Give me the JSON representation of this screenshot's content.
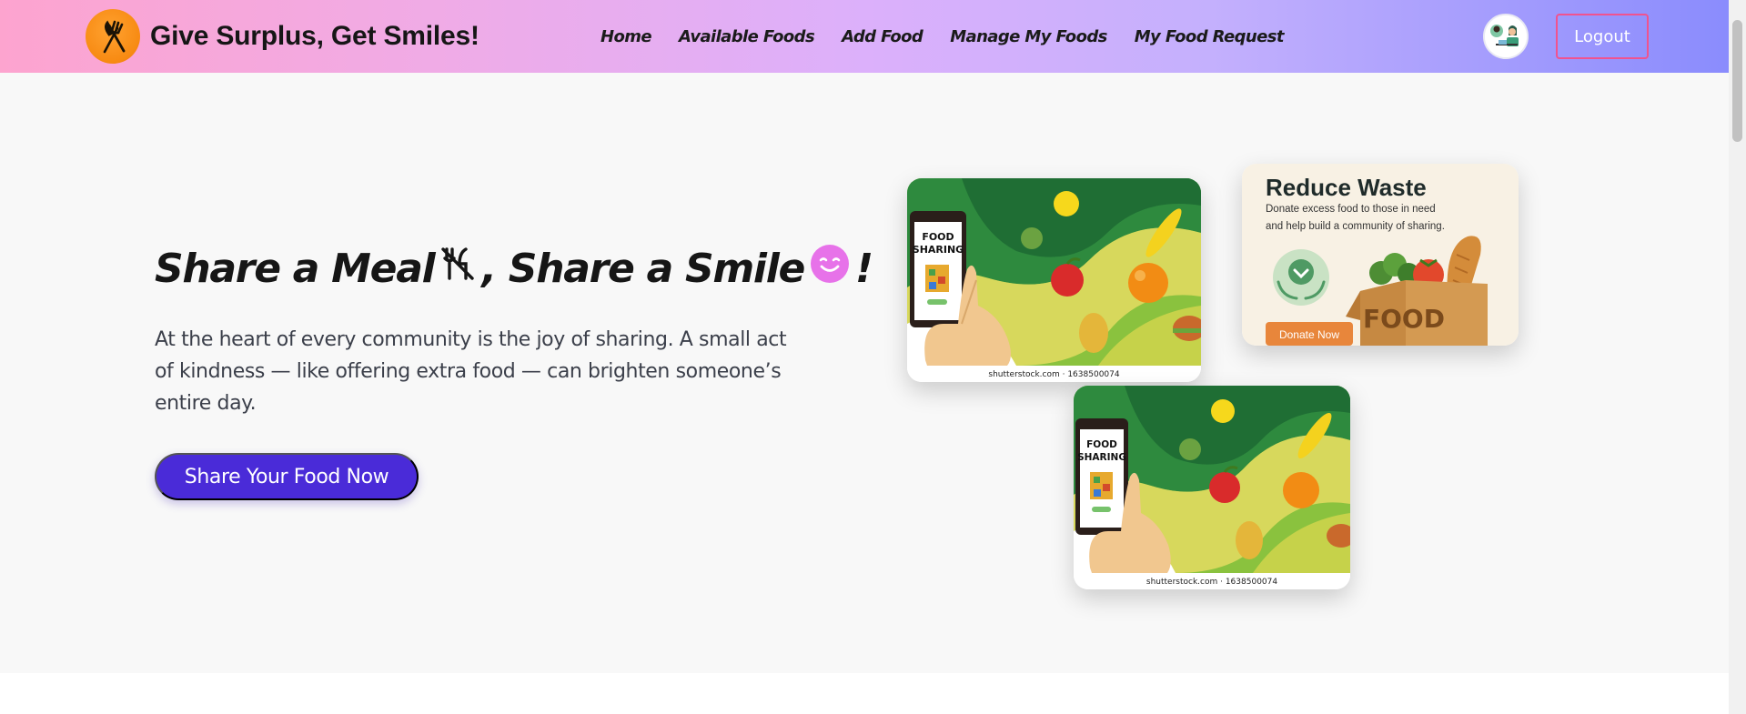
{
  "brand": {
    "title": "Give Surplus, Get Smiles!"
  },
  "nav": {
    "links": [
      "Home",
      "Available Foods",
      "Add Food",
      "Manage My Foods",
      "My Food Request"
    ],
    "logout": "Logout"
  },
  "hero": {
    "headline_part1": "Share a Meal",
    "headline_part2": ", Share a Smile",
    "headline_part3": "!",
    "description": "At the heart of every community is the joy of sharing. A small act of kindness — like offering extra food — can brighten someone’s entire day.",
    "cta": "Share Your Food Now"
  },
  "cards": {
    "sharing_label_line1": "FOOD",
    "sharing_label_line2": "SHARING",
    "caption": "shutterstock.com · 1638500074",
    "reduce_title": "Reduce Waste",
    "reduce_line1": "Donate excess food to those in need",
    "reduce_line2": "and help build a community of sharing.",
    "donate_button": "Donate Now",
    "box_label": "FOOD"
  },
  "colors": {
    "accent": "#4a2bd8",
    "logout_border": "#f0538f",
    "logo_orange": "#f78a12",
    "smile_pink": "#e772e9"
  },
  "icons": {
    "logo": "fork-knife-icon",
    "headline_icon": "no-food-icon",
    "headline_emoji": "smile-emoji-icon"
  }
}
